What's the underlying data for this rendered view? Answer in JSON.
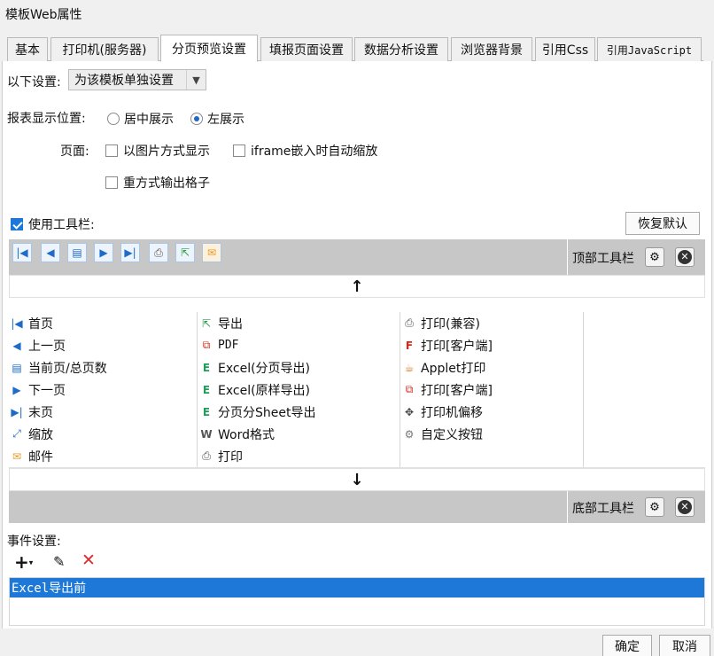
{
  "window": {
    "title": "模板Web属性"
  },
  "tabs": [
    {
      "label": "基本"
    },
    {
      "label": "打印机(服务器)"
    },
    {
      "label": "分页预览设置",
      "active": true
    },
    {
      "label": "填报页面设置"
    },
    {
      "label": "数据分析设置"
    },
    {
      "label": "浏览器背景"
    },
    {
      "label": "引用Css"
    },
    {
      "label": "引用JavaScript"
    }
  ],
  "settings": {
    "scope_label": "以下设置:",
    "scope_value": "为该模板单独设置"
  },
  "display": {
    "position_label": "报表显示位置:",
    "center_label": "居中展示",
    "left_label": "左展示",
    "selected": "left",
    "page_label": "页面:",
    "image_mode_label": "以图片方式显示",
    "iframe_label": "iframe嵌入时自动缩放",
    "repeat_label": "重方式输出格子"
  },
  "toolbar": {
    "use_label": "使用工具栏:",
    "use_checked": true,
    "restore_label": "恢复默认",
    "top_label": "顶部工具栏",
    "bottom_label": "底部工具栏",
    "up_arrow": "↑",
    "down_arrow": "↓"
  },
  "buttons_grid": {
    "col1": [
      {
        "label": "首页",
        "icon": "first-page-icon"
      },
      {
        "label": "上一页",
        "icon": "prev-page-icon"
      },
      {
        "label": "当前页/总页数",
        "icon": "page-count-icon"
      },
      {
        "label": "下一页",
        "icon": "next-page-icon"
      },
      {
        "label": "末页",
        "icon": "last-page-icon"
      },
      {
        "label": "缩放",
        "icon": "zoom-icon"
      },
      {
        "label": "邮件",
        "icon": "mail-icon"
      }
    ],
    "col2": [
      {
        "label": "导出",
        "icon": "export-icon"
      },
      {
        "label": "PDF",
        "icon": "pdf-icon"
      },
      {
        "label": "Excel(分页导出)",
        "icon": "excel-icon"
      },
      {
        "label": "Excel(原样导出)",
        "icon": "excel-icon"
      },
      {
        "label": "分页分Sheet导出",
        "icon": "excel-icon"
      },
      {
        "label": "Word格式",
        "icon": "word-icon"
      },
      {
        "label": "打印",
        "icon": "printer-icon"
      }
    ],
    "col3": [
      {
        "label": "打印(兼容)",
        "icon": "printer-icon"
      },
      {
        "label": "打印[客户端]",
        "icon": "flash-print-icon"
      },
      {
        "label": "Applet打印",
        "icon": "java-icon"
      },
      {
        "label": "打印[客户端]",
        "icon": "pdf-print-icon"
      },
      {
        "label": "打印机偏移",
        "icon": "move-icon"
      },
      {
        "label": "自定义按钮",
        "icon": "gear-icon"
      }
    ]
  },
  "events": {
    "label": "事件设置:",
    "items": [
      "Excel导出前"
    ]
  },
  "dialog": {
    "ok_label": "确定",
    "cancel_label": "取消"
  },
  "colors": {
    "accent": "#1e78d7",
    "bar_grey": "#c7c7c7"
  }
}
